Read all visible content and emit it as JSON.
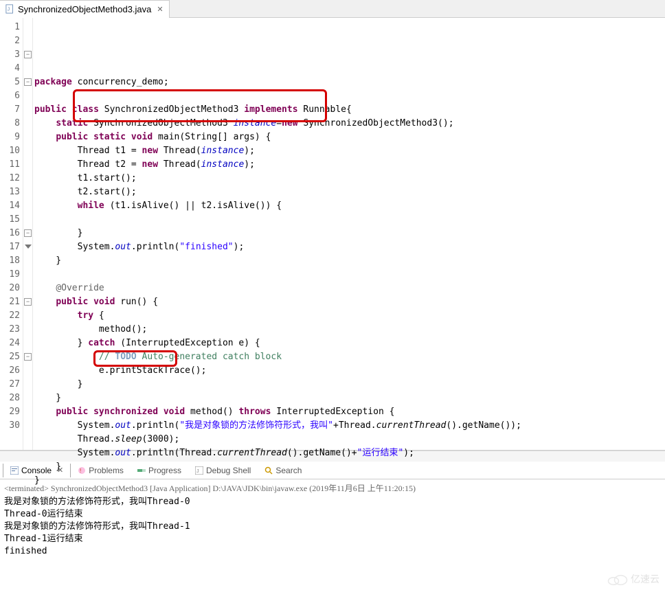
{
  "tab": {
    "filename": "SynchronizedObjectMethod3.java"
  },
  "code": {
    "lines": [
      {
        "n": "1",
        "parts": [
          {
            "t": "package",
            "c": "kw"
          },
          {
            "t": " concurrency_demo;"
          }
        ]
      },
      {
        "n": "2",
        "parts": []
      },
      {
        "n": "3",
        "parts": [
          {
            "t": "public",
            "c": "kw"
          },
          {
            "t": " "
          },
          {
            "t": "class",
            "c": "kw"
          },
          {
            "t": " SynchronizedObjectMethod3 "
          },
          {
            "t": "implements",
            "c": "kw"
          },
          {
            "t": " Runnable{"
          }
        ]
      },
      {
        "n": "4",
        "parts": [
          {
            "t": "    "
          },
          {
            "t": "static",
            "c": "kw"
          },
          {
            "t": " SynchronizedObjectMethod3 "
          },
          {
            "t": "instance",
            "c": "fld"
          },
          {
            "t": "="
          },
          {
            "t": "new",
            "c": "kw"
          },
          {
            "t": " SynchronizedObjectMethod3();"
          }
        ]
      },
      {
        "n": "5",
        "parts": [
          {
            "t": "    "
          },
          {
            "t": "public",
            "c": "kw"
          },
          {
            "t": " "
          },
          {
            "t": "static",
            "c": "kw"
          },
          {
            "t": " "
          },
          {
            "t": "void",
            "c": "kw"
          },
          {
            "t": " main(String[] args) {"
          }
        ]
      },
      {
        "n": "6",
        "parts": [
          {
            "t": "        Thread t1 = "
          },
          {
            "t": "new",
            "c": "kw"
          },
          {
            "t": " Thread("
          },
          {
            "t": "instance",
            "c": "fld"
          },
          {
            "t": ");"
          }
        ]
      },
      {
        "n": "7",
        "parts": [
          {
            "t": "        Thread t2 = "
          },
          {
            "t": "new",
            "c": "kw"
          },
          {
            "t": " Thread("
          },
          {
            "t": "instance",
            "c": "fld"
          },
          {
            "t": ");"
          }
        ]
      },
      {
        "n": "8",
        "parts": [
          {
            "t": "        t1.start();"
          }
        ]
      },
      {
        "n": "9",
        "parts": [
          {
            "t": "        t2.start();"
          }
        ]
      },
      {
        "n": "10",
        "parts": [
          {
            "t": "        "
          },
          {
            "t": "while",
            "c": "kw"
          },
          {
            "t": " (t1.isAlive() || t2.isAlive()) {"
          }
        ]
      },
      {
        "n": "11",
        "parts": []
      },
      {
        "n": "12",
        "parts": [
          {
            "t": "        }"
          }
        ]
      },
      {
        "n": "13",
        "parts": [
          {
            "t": "        System."
          },
          {
            "t": "out",
            "c": "fld"
          },
          {
            "t": ".println("
          },
          {
            "t": "\"finished\"",
            "c": "str"
          },
          {
            "t": ");"
          }
        ]
      },
      {
        "n": "14",
        "parts": [
          {
            "t": "    }"
          }
        ]
      },
      {
        "n": "15",
        "parts": []
      },
      {
        "n": "16",
        "parts": [
          {
            "t": "    "
          },
          {
            "t": "@Override",
            "c": "gray"
          }
        ]
      },
      {
        "n": "17",
        "parts": [
          {
            "t": "    "
          },
          {
            "t": "public",
            "c": "kw"
          },
          {
            "t": " "
          },
          {
            "t": "void",
            "c": "kw"
          },
          {
            "t": " run() {"
          }
        ]
      },
      {
        "n": "18",
        "parts": [
          {
            "t": "        "
          },
          {
            "t": "try",
            "c": "kw"
          },
          {
            "t": " {"
          }
        ]
      },
      {
        "n": "19",
        "parts": [
          {
            "t": "            method();"
          }
        ]
      },
      {
        "n": "20",
        "parts": [
          {
            "t": "        } "
          },
          {
            "t": "catch",
            "c": "kw"
          },
          {
            "t": " (InterruptedException e) {"
          }
        ]
      },
      {
        "n": "21",
        "parts": [
          {
            "t": "            "
          },
          {
            "t": "// ",
            "c": "com"
          },
          {
            "t": "TODO",
            "c": "todo-kw"
          },
          {
            "t": " Auto-generated catch block",
            "c": "com"
          }
        ]
      },
      {
        "n": "22",
        "parts": [
          {
            "t": "            e.printStackTrace();"
          }
        ]
      },
      {
        "n": "23",
        "parts": [
          {
            "t": "        }"
          }
        ]
      },
      {
        "n": "24",
        "parts": [
          {
            "t": "    }"
          }
        ]
      },
      {
        "n": "25",
        "parts": [
          {
            "t": "    "
          },
          {
            "t": "public",
            "c": "kw"
          },
          {
            "t": " "
          },
          {
            "t": "synchronized",
            "c": "kw"
          },
          {
            "t": " "
          },
          {
            "t": "void",
            "c": "kw"
          },
          {
            "t": " method() "
          },
          {
            "t": "throws",
            "c": "kw"
          },
          {
            "t": " InterruptedException {"
          }
        ]
      },
      {
        "n": "26",
        "parts": [
          {
            "t": "        System."
          },
          {
            "t": "out",
            "c": "fld"
          },
          {
            "t": ".println("
          },
          {
            "t": "\"我是对象锁的方法修饰符形式，我叫\"",
            "c": "str"
          },
          {
            "t": "+Thread."
          },
          {
            "t": "currentThread",
            "c": "mtd"
          },
          {
            "t": "().getName());"
          }
        ]
      },
      {
        "n": "27",
        "parts": [
          {
            "t": "        Thread."
          },
          {
            "t": "sleep",
            "c": "mtd"
          },
          {
            "t": "(3000);"
          }
        ]
      },
      {
        "n": "28",
        "parts": [
          {
            "t": "        System."
          },
          {
            "t": "out",
            "c": "fld"
          },
          {
            "t": ".println(Thread."
          },
          {
            "t": "currentThread",
            "c": "mtd"
          },
          {
            "t": "().getName()+"
          },
          {
            "t": "\"运行结束\"",
            "c": "str"
          },
          {
            "t": ");"
          }
        ]
      },
      {
        "n": "29",
        "parts": [
          {
            "t": "    }"
          }
        ]
      },
      {
        "n": "30",
        "parts": [
          {
            "t": "}"
          }
        ]
      }
    ]
  },
  "bottom_tabs": {
    "console": "Console",
    "problems": "Problems",
    "progress": "Progress",
    "debug_shell": "Debug Shell",
    "search": "Search"
  },
  "console": {
    "header_prefix": "<terminated>",
    "header": "SynchronizedObjectMethod3 [Java Application] D:\\JAVA\\JDK\\bin\\javaw.exe (2019年11月6日 上午11:20:15)",
    "lines": [
      "我是对象锁的方法修饰符形式，我叫Thread-0",
      "Thread-0运行结束",
      "我是对象锁的方法修饰符形式，我叫Thread-1",
      "Thread-1运行结束",
      "finished"
    ]
  },
  "watermark": "亿速云"
}
